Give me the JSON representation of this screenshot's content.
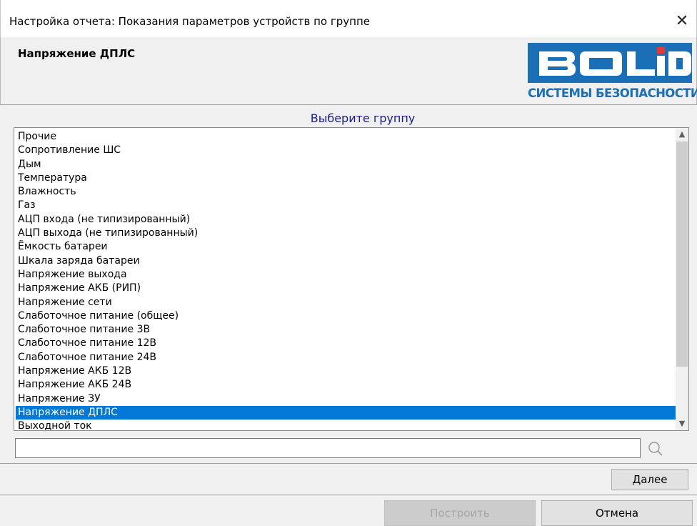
{
  "window": {
    "title": "Настройка отчета: Показания параметров устройств по группе",
    "close_label": "✕"
  },
  "header": {
    "report_name": "Напряжение ДПЛС",
    "logo": {
      "brand": "BOLID",
      "tagline": "СИСТЕМЫ БЕЗОПАСНОСТИ",
      "brand_color": "#1a6fb6"
    }
  },
  "group_prompt": "Выберите группу",
  "groups": {
    "selected_index": 20,
    "items": [
      "Прочие",
      "Сопротивление ШС",
      "Дым",
      "Температура",
      "Влажность",
      "Газ",
      "АЦП входа (не типизированный)",
      "АЦП выхода (не типизированный)",
      "Ёмкость батареи",
      "Шкала заряда батареи",
      "Напряжение выхода",
      "Напряжение АКБ (РИП)",
      "Напряжение сети",
      "Слаботочное питание (общее)",
      "Слаботочное питание 3В",
      "Слаботочное питание 12В",
      "Слаботочное питание 24В",
      "Напряжение АКБ 12В",
      "Напряжение АКБ 24В",
      "Напряжение ЗУ",
      "Напряжение ДПЛС",
      "Выходной ток"
    ]
  },
  "search": {
    "value": "",
    "placeholder": "",
    "icon": "search-icon"
  },
  "buttons": {
    "next": "Далее",
    "build": "Построить",
    "cancel": "Отмена"
  },
  "colors": {
    "selection": "#0078d7",
    "prompt_text": "#1c1c8c"
  }
}
